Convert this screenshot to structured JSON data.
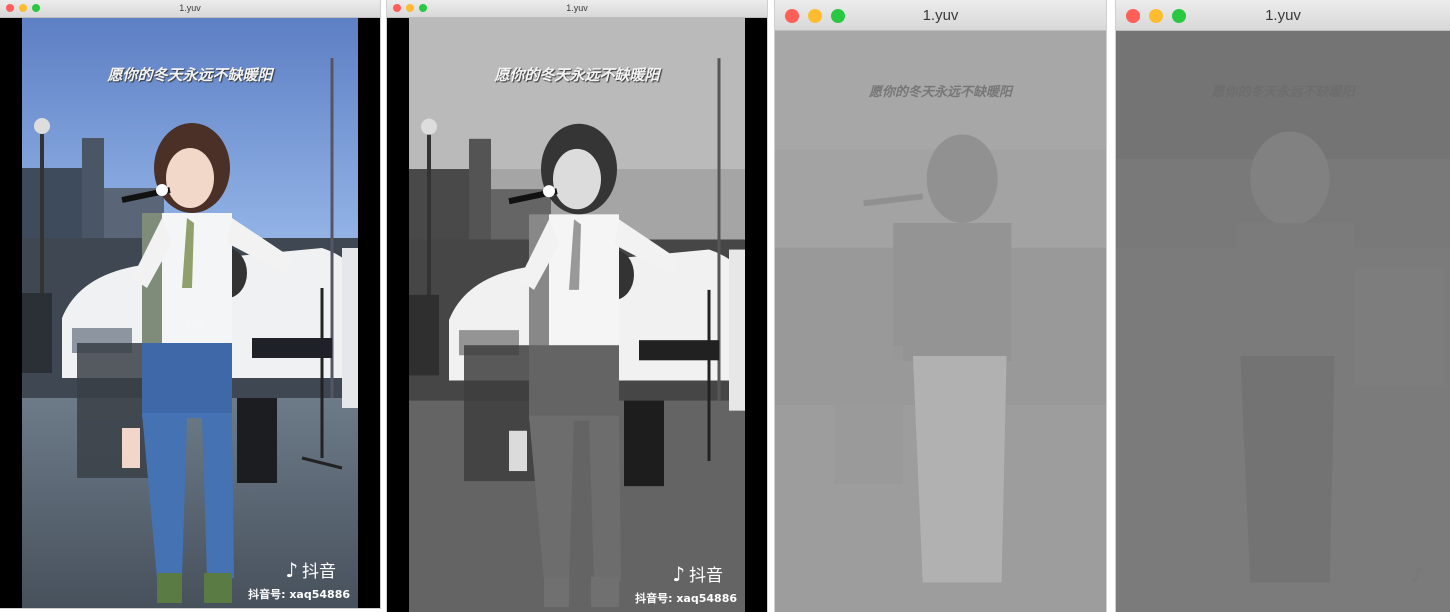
{
  "windows": [
    {
      "title": "1.yuv",
      "mode": "color"
    },
    {
      "title": "1.yuv",
      "mode": "luma"
    },
    {
      "title": "1.yuv",
      "mode": "chroma-u"
    },
    {
      "title": "1.yuv",
      "mode": "chroma-v"
    }
  ],
  "overlay": {
    "caption": "愿你的冬天永远不缺暖阳",
    "app_name": "抖音",
    "app_handle": "抖音号: xaq54886"
  },
  "icons": {
    "close": "close-traffic-light",
    "minimize": "minimize-traffic-light",
    "zoom": "zoom-traffic-light",
    "app_logo": "musical-note-icon"
  }
}
